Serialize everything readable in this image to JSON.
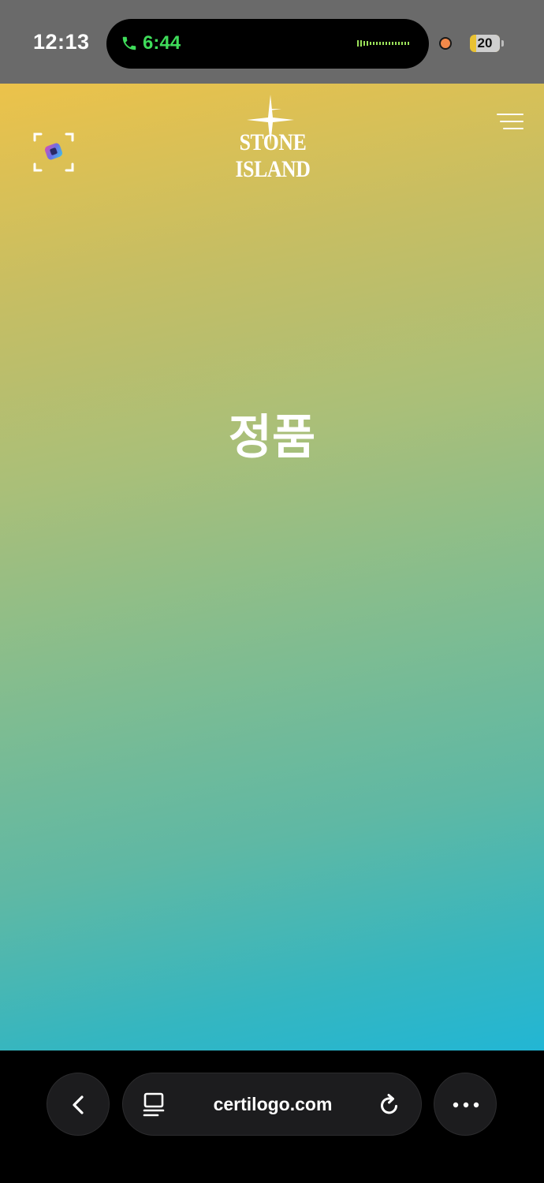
{
  "status_bar": {
    "time": "12:13",
    "call_timer": "6:44",
    "battery_level": "20",
    "call_icon": "phone-icon",
    "call_color": "#3fdc5a"
  },
  "header": {
    "brand": "STONE ISLAND",
    "logo_icon": "compass-star-icon",
    "scan_icon": "scan-frame-icon",
    "menu_icon": "menu-icon"
  },
  "main": {
    "verification_result": "정품"
  },
  "browser": {
    "url": "certilogo.com",
    "back_icon": "chevron-left-icon",
    "tabs_icon": "tabs-icon",
    "reload_icon": "reload-icon",
    "more_icon": "more-icon"
  },
  "colors": {
    "gradient_top": "#ecc24a",
    "gradient_bottom": "#22b6d4"
  }
}
